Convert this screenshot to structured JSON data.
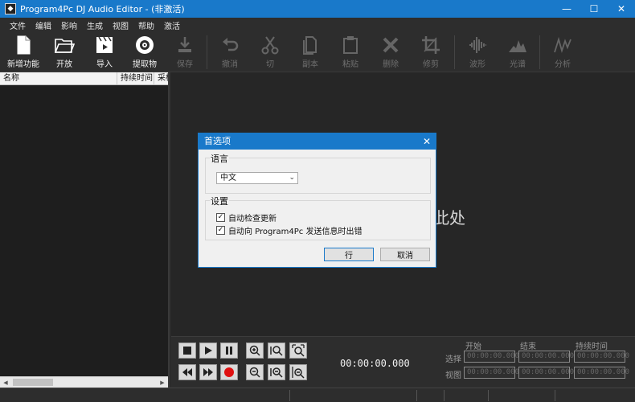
{
  "window": {
    "title": "Program4Pc DJ Audio Editor - (非激活)",
    "minimize": "—",
    "maximize": "☐",
    "close": "✕"
  },
  "menu": [
    "文件",
    "编辑",
    "影响",
    "生成",
    "视图",
    "帮助",
    "激活"
  ],
  "toolbar": [
    {
      "label": "新增功能",
      "icon": "new-file-icon",
      "enabled": true
    },
    {
      "label": "开放",
      "icon": "folder-open-icon",
      "enabled": true
    },
    {
      "label": "导入",
      "icon": "clapperboard-icon",
      "enabled": true
    },
    {
      "label": "提取物",
      "icon": "disc-icon",
      "enabled": true
    },
    {
      "label": "保存",
      "icon": "save-icon",
      "enabled": false
    },
    {
      "label": "撤消",
      "icon": "undo-icon",
      "enabled": false
    },
    {
      "label": "切",
      "icon": "scissors-icon",
      "enabled": false
    },
    {
      "label": "副本",
      "icon": "copy-icon",
      "enabled": false
    },
    {
      "label": "粘贴",
      "icon": "paste-icon",
      "enabled": false
    },
    {
      "label": "删除",
      "icon": "delete-x-icon",
      "enabled": false
    },
    {
      "label": "修剪",
      "icon": "crop-icon",
      "enabled": false
    },
    {
      "label": "波形",
      "icon": "waveform-icon",
      "enabled": false
    },
    {
      "label": "光谱",
      "icon": "spectrum-icon",
      "enabled": false
    },
    {
      "label": "分析",
      "icon": "analysis-icon",
      "enabled": false
    }
  ],
  "file_list": {
    "columns": [
      "名称",
      "持续时间",
      "采样"
    ]
  },
  "workspace": {
    "drop_hint": "此处"
  },
  "transport": {
    "timecode": "00:00:00.000",
    "headers": [
      "开始",
      "结束",
      "持续时间"
    ],
    "rows": [
      {
        "label": "选择",
        "values": [
          "00:00:00.000",
          "00:00:00.000",
          "00:00:00.000"
        ]
      },
      {
        "label": "视图",
        "values": [
          "00:00:00.000",
          "00:00:00.000",
          "00:00:00.000"
        ]
      }
    ]
  },
  "dialog": {
    "title": "首选项",
    "close": "✕",
    "language_group": "语言",
    "language_value": "中文",
    "settings_group": "设置",
    "options": [
      {
        "label": "自动检查更新",
        "checked": true
      },
      {
        "label": "自动向 Program4Pc 发送信息时出错",
        "checked": true
      }
    ],
    "ok": "行",
    "cancel": "取消"
  },
  "colors": {
    "accent": "#1979ca",
    "record": "#e01010"
  }
}
